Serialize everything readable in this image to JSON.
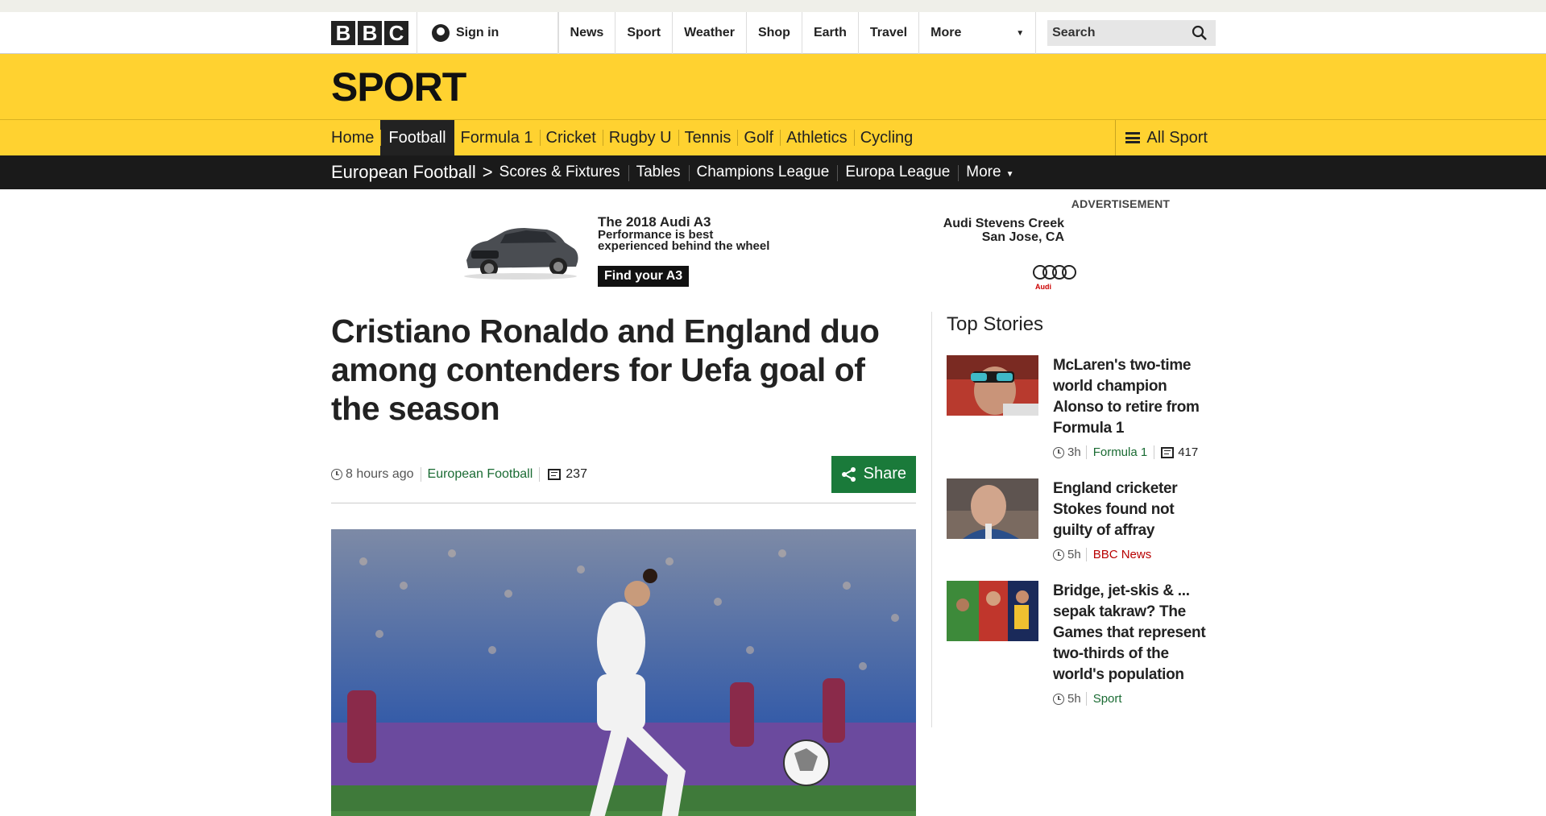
{
  "global": {
    "logo_letters": [
      "B",
      "B",
      "C"
    ],
    "signin_label": "Sign in",
    "nav": [
      "News",
      "Sport",
      "Weather",
      "Shop",
      "Earth",
      "Travel"
    ],
    "more_label": "More",
    "search_placeholder": "Search"
  },
  "sport": {
    "title": "SPORT",
    "nav": [
      "Home",
      "Football",
      "Formula 1",
      "Cricket",
      "Rugby U",
      "Tennis",
      "Golf",
      "Athletics",
      "Cycling"
    ],
    "active": "Football",
    "all_sport_label": "All Sport"
  },
  "secondary": {
    "section": "European Football",
    "separator": ">",
    "links": [
      "Scores & Fixtures",
      "Tables",
      "Champions League",
      "Europa League",
      "More"
    ]
  },
  "ad": {
    "label": "ADVERTISEMENT",
    "headline_1": "The 2018 Audi A3",
    "headline_2": "Performance is best",
    "headline_3": "experienced behind the wheel",
    "cta": "Find your A3",
    "dealer_1": "Audi Stevens Creek",
    "dealer_2": "San Jose, CA",
    "brand": "Audi"
  },
  "article": {
    "headline": "Cristiano Ronaldo and England duo among contenders for Uefa goal of the season",
    "time": "8 hours ago",
    "category": "European Football",
    "comments": "237",
    "share_label": "Share"
  },
  "top_stories": {
    "heading": "Top Stories",
    "items": [
      {
        "title": "McLaren's two-time world champion Alonso to retire from Formula 1",
        "time": "3h",
        "category": "Formula 1",
        "comments": "417"
      },
      {
        "title": "England cricketer Stokes found not guilty of affray",
        "time": "5h",
        "category": "BBC News"
      },
      {
        "title": "Bridge, jet-skis & ... sepak takraw? The Games that represent two-thirds of the world's population",
        "time": "5h",
        "category": "Sport"
      }
    ]
  },
  "colors": {
    "sport_yellow": "#ffd230",
    "nav_black": "#1a1a1a",
    "share_green": "#1a7a3a",
    "link_green": "#1a6b33",
    "news_red": "#b80000"
  }
}
